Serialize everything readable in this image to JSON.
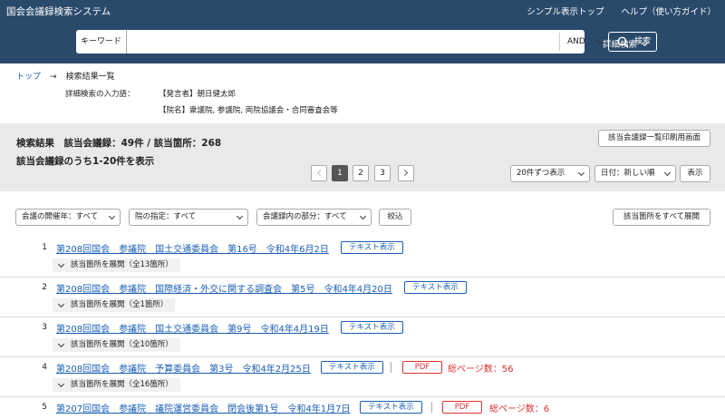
{
  "header": {
    "title": "国会会議録検索システム",
    "links": [
      "シンプル表示トップ",
      "ヘルプ（使い方ガイド）"
    ],
    "search_label": "キーワード",
    "search_value": "",
    "operator": "AND",
    "search_button": "検索",
    "advanced": "詳細検索"
  },
  "breadcrumb": {
    "home": "トップ",
    "current": "検索結果一覧"
  },
  "conditions": {
    "label": "詳細検索の入力語：",
    "items": [
      "【発言者】朝日健太郎",
      "【院名】衆議院, 参議院, 両院協議会・合同審査会等"
    ]
  },
  "results": {
    "summary": "検索結果　該当会議録：49件 / 該当箇所：268",
    "range": "該当会議録のうち1-20件を表示",
    "print_button": "該当会議録一覧印刷用画面",
    "pages": [
      "1",
      "2",
      "3"
    ],
    "current_page": "1",
    "per_page": "20件ずつ表示",
    "sort": "日付：新しい順",
    "show_button": "表示"
  },
  "filters": {
    "year": "会議の開催年：すべて",
    "house": "院の指定：すべて",
    "part": "会議録内の部分：すべて",
    "narrow_button": "絞込",
    "expand_all_button": "該当箇所をすべて展開"
  },
  "items": [
    {
      "num": "1",
      "title": "第208回国会　参議院　国土交通委員会　第16号　令和4年6月2日",
      "text_btn": "テキスト表示",
      "expand": "該当箇所を展開（全13箇所）",
      "pdf": "",
      "pages": ""
    },
    {
      "num": "2",
      "title": "第208回国会　参議院　国際経済・外交に関する調査会　第5号　令和4年4月20日",
      "text_btn": "テキスト表示",
      "expand": "該当箇所を展開（全1箇所）",
      "pdf": "",
      "pages": ""
    },
    {
      "num": "3",
      "title": "第208回国会　参議院　国土交通委員会　第9号　令和4年4月19日",
      "text_btn": "テキスト表示",
      "expand": "該当箇所を展開（全10箇所）",
      "pdf": "",
      "pages": ""
    },
    {
      "num": "4",
      "title": "第208回国会　参議院　予算委員会　第3号　令和4年2月25日",
      "text_btn": "テキスト表示",
      "expand": "該当箇所を展開（全16箇所）",
      "pdf": "PDF",
      "pages": "総ページ数：56"
    },
    {
      "num": "5",
      "title": "第207回国会　参議院　議院運営委員会　閉会後第1号　令和4年1月7日",
      "text_btn": "テキスト表示",
      "expand": "",
      "pdf": "PDF",
      "pages": "総ページ数：6"
    }
  ]
}
